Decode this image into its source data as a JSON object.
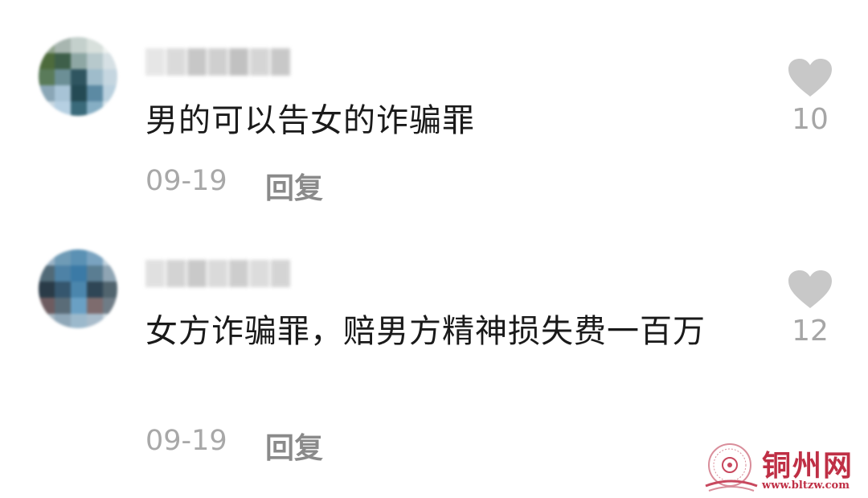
{
  "comments": [
    {
      "text": "男的可以告女的诈骗罪",
      "date": "09-19",
      "reply_label": "回复",
      "like_count": "10",
      "like_icon": "heart-icon"
    },
    {
      "text": "女方诈骗罪，赔男方精神损失费一百万",
      "date": "09-19",
      "reply_label": "回复",
      "like_count": "12",
      "like_icon": "heart-icon"
    }
  ],
  "watermark": {
    "title": "铜州网",
    "url": "www.bltzw.com"
  },
  "colors": {
    "heart": "#c8c8c8",
    "meta_text": "#a8a8a8",
    "watermark": "#bf2f45"
  }
}
